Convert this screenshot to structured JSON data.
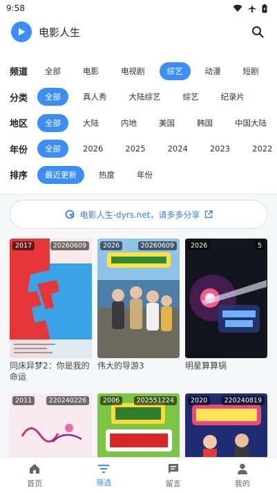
{
  "status": {
    "time": "9:58"
  },
  "header": {
    "title": "电影人生"
  },
  "filters": [
    {
      "label": "频道",
      "options": [
        "全部",
        "电影",
        "电视剧",
        "综艺",
        "动漫",
        "短剧"
      ],
      "active": 3
    },
    {
      "label": "分类",
      "options": [
        "全部",
        "真人秀",
        "大陆综艺",
        "综艺",
        "纪录片"
      ],
      "active": 0
    },
    {
      "label": "地区",
      "options": [
        "全部",
        "大陆",
        "内地",
        "美国",
        "韩国",
        "中国大陆"
      ],
      "active": 0
    },
    {
      "label": "年份",
      "options": [
        "全部",
        "2026",
        "2025",
        "2024",
        "2023",
        "2022"
      ],
      "active": 0
    },
    {
      "label": "排序",
      "options": [
        "最近更新",
        "热度",
        "年份"
      ],
      "active": 0
    }
  ],
  "share": {
    "text": "电影人生-dyrs.net，请多多分享"
  },
  "cards": [
    {
      "year": "2017",
      "date": "20260609",
      "title": "同床异梦2：你是我的命运"
    },
    {
      "year": "2026",
      "date": "20260609",
      "title": "伟大的导游3"
    },
    {
      "year": "2026",
      "date": "5",
      "title": "明星算算锅"
    },
    {
      "year": "2011",
      "date": "220240226",
      "title": ""
    },
    {
      "year": "2006",
      "date": "202551224",
      "title": ""
    },
    {
      "year": "2020",
      "date": "220240819",
      "title": ""
    }
  ],
  "tabs": [
    {
      "label": "首页",
      "icon": "home-icon"
    },
    {
      "label": "筛选",
      "icon": "filter-icon"
    },
    {
      "label": "留言",
      "icon": "message-icon"
    },
    {
      "label": "我的",
      "icon": "profile-icon"
    }
  ],
  "colors": {
    "accent": "#3a8ef6"
  }
}
